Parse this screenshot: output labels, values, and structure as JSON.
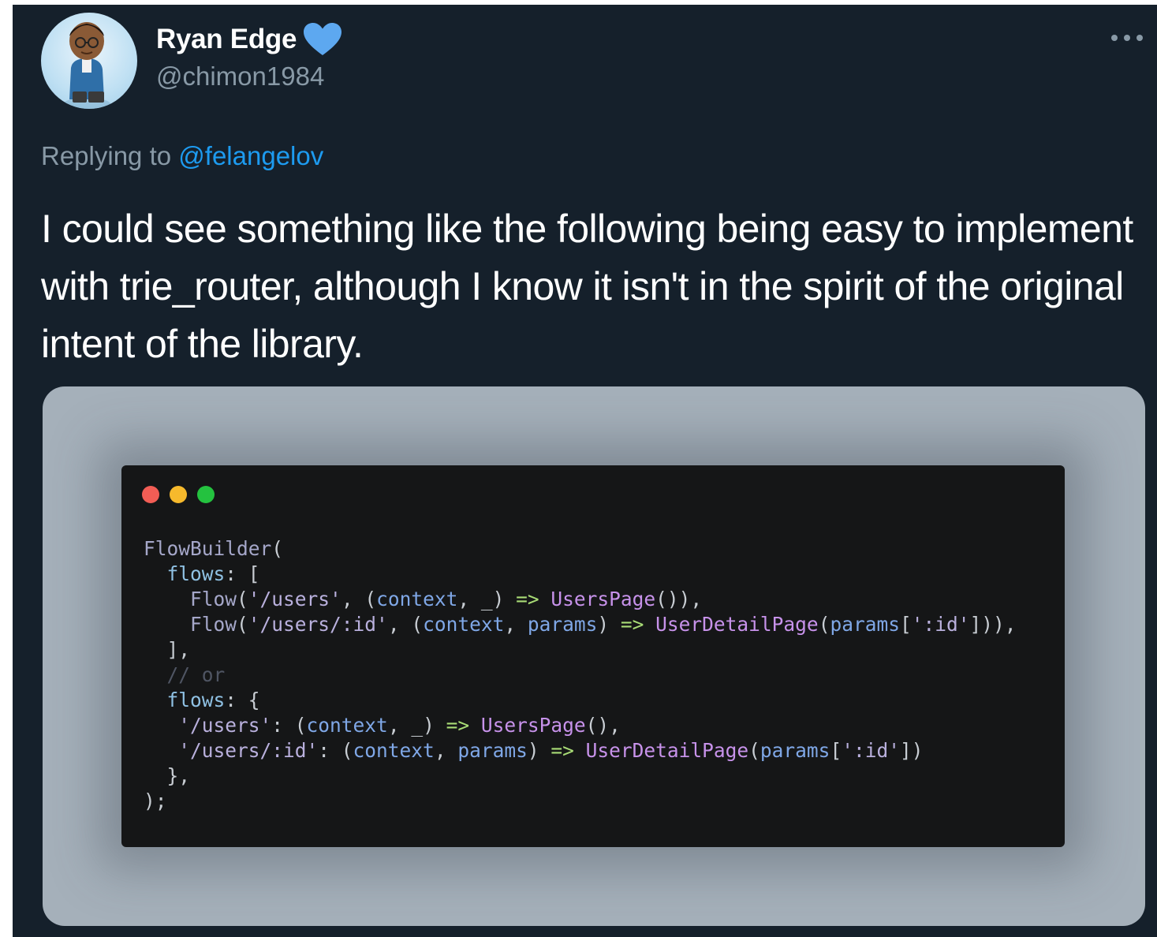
{
  "tweet": {
    "display_name": "Ryan Edge",
    "handle": "@chimon1984",
    "verified_icon": "verified-heart-icon",
    "more_icon": "more-options-icon",
    "reply_prefix": "Replying to",
    "reply_mention": "@felangelov",
    "text": "I could see something like the following being easy to implement with trie_router, although I know it isn't in the spirit of the original intent of the library.",
    "avatar": "cartoon character avatar"
  },
  "colors": {
    "background": "#15202b",
    "name": "#ffffff",
    "secondary": "#8899a6",
    "mention": "#1d9bf0",
    "verified": "#5da8f0",
    "media_bg": "#a5b0ba",
    "code_bg": "#151617",
    "dot_red": "#f25d55",
    "dot_yellow": "#f6b92c",
    "dot_green": "#24c23f"
  },
  "code_snippet": {
    "lines": [
      [
        [
          "tk-class",
          "FlowBuilder"
        ],
        [
          "tk-punc",
          "("
        ]
      ],
      [
        [
          "tk-punc",
          "  "
        ],
        [
          "tk-prop",
          "flows"
        ],
        [
          "tk-punc",
          ": ["
        ]
      ],
      [
        [
          "tk-punc",
          "    "
        ],
        [
          "tk-class",
          "Flow"
        ],
        [
          "tk-punc",
          "("
        ],
        [
          "tk-str",
          "'/users'"
        ],
        [
          "tk-punc",
          ", ("
        ],
        [
          "tk-param",
          "context"
        ],
        [
          "tk-punc",
          ", _) "
        ],
        [
          "tk-arrow",
          "=>"
        ],
        [
          "tk-punc",
          " "
        ],
        [
          "tk-call",
          "UsersPage"
        ],
        [
          "tk-punc",
          "()),"
        ]
      ],
      [
        [
          "tk-punc",
          "    "
        ],
        [
          "tk-class",
          "Flow"
        ],
        [
          "tk-punc",
          "("
        ],
        [
          "tk-str",
          "'/users/:id'"
        ],
        [
          "tk-punc",
          ", ("
        ],
        [
          "tk-param",
          "context"
        ],
        [
          "tk-punc",
          ", "
        ],
        [
          "tk-param",
          "params"
        ],
        [
          "tk-punc",
          ") "
        ],
        [
          "tk-arrow",
          "=>"
        ],
        [
          "tk-punc",
          " "
        ],
        [
          "tk-call",
          "UserDetailPage"
        ],
        [
          "tk-punc",
          "("
        ],
        [
          "tk-param",
          "params"
        ],
        [
          "tk-punc",
          "["
        ],
        [
          "tk-str",
          "':id'"
        ],
        [
          "tk-punc",
          "])),"
        ]
      ],
      [
        [
          "tk-punc",
          "  ],"
        ]
      ],
      [
        [
          "tk-punc",
          "  "
        ],
        [
          "tk-comment",
          "// or"
        ]
      ],
      [
        [
          "tk-punc",
          "  "
        ],
        [
          "tk-prop",
          "flows"
        ],
        [
          "tk-punc",
          ": {"
        ]
      ],
      [
        [
          "tk-punc",
          "   "
        ],
        [
          "tk-str",
          "'/users'"
        ],
        [
          "tk-punc",
          ": ("
        ],
        [
          "tk-param",
          "context"
        ],
        [
          "tk-punc",
          ", _) "
        ],
        [
          "tk-arrow",
          "=>"
        ],
        [
          "tk-punc",
          " "
        ],
        [
          "tk-call",
          "UsersPage"
        ],
        [
          "tk-punc",
          "(),"
        ]
      ],
      [
        [
          "tk-punc",
          "   "
        ],
        [
          "tk-str",
          "'/users/:id'"
        ],
        [
          "tk-punc",
          ": ("
        ],
        [
          "tk-param",
          "context"
        ],
        [
          "tk-punc",
          ", "
        ],
        [
          "tk-param",
          "params"
        ],
        [
          "tk-punc",
          ") "
        ],
        [
          "tk-arrow",
          "=>"
        ],
        [
          "tk-punc",
          " "
        ],
        [
          "tk-call",
          "UserDetailPage"
        ],
        [
          "tk-punc",
          "("
        ],
        [
          "tk-param",
          "params"
        ],
        [
          "tk-punc",
          "["
        ],
        [
          "tk-str",
          "':id'"
        ],
        [
          "tk-punc",
          "])"
        ]
      ],
      [
        [
          "tk-punc",
          "  },"
        ]
      ],
      [
        [
          "tk-punc",
          ");"
        ]
      ]
    ]
  }
}
